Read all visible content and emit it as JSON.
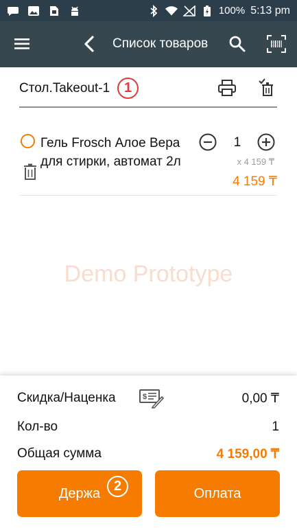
{
  "statusbar": {
    "battery": "100%",
    "time": "5:13 pm",
    "icons": [
      "message-icon",
      "image-icon",
      "sim-icon",
      "android-icon",
      "bluetooth-icon",
      "wifi-icon",
      "signal-icon",
      "battery-icon"
    ]
  },
  "appbar": {
    "title": "Список товаров",
    "icons": [
      "menu-icon",
      "back-arrow-icon",
      "search-icon",
      "barcode-scan-icon"
    ]
  },
  "order": {
    "name": "Стол.Takeout-1",
    "badge_1": "1"
  },
  "items": [
    {
      "name": "Гель Frosch Алое Вера для стирки, автомат 2л",
      "qty": "1",
      "unit_price": "x 4 159 ₸",
      "total": "4 159 ₸"
    }
  ],
  "watermark": "Demo Prototype",
  "summary": {
    "discount_label": "Скидка/Наценка",
    "discount_value": "0,00 ₸",
    "qty_label": "Кол-во",
    "qty_value": "1",
    "total_label": "Общая сумма",
    "total_value": "4 159,00 ₸"
  },
  "buttons": {
    "hold": "Держа",
    "pay": "Оплата",
    "badge_2": "2"
  },
  "colors": {
    "accent": "#f57c00",
    "appbar": "#36474f",
    "statusbar": "#2c3e4a",
    "badge": "#e53935"
  }
}
